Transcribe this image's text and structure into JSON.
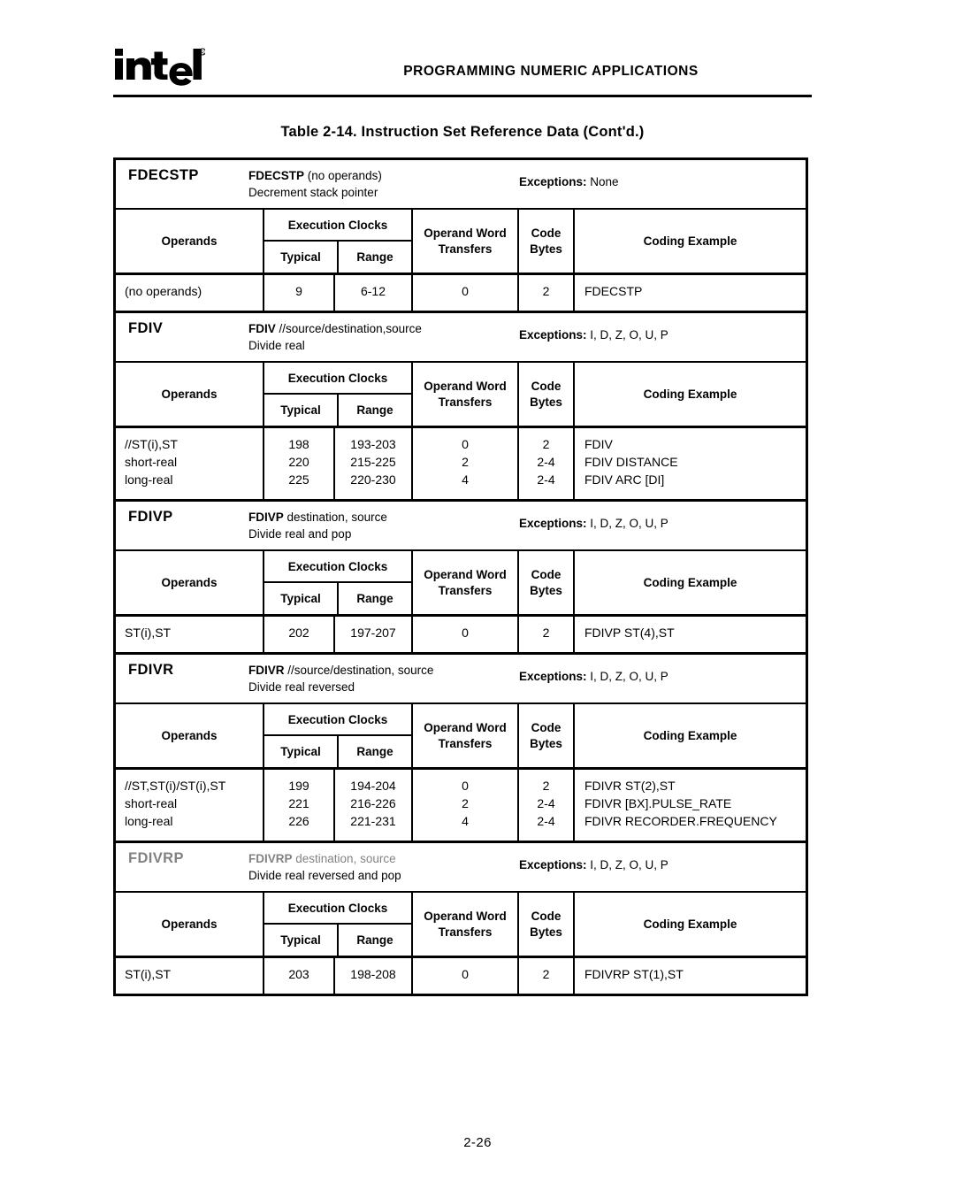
{
  "header": {
    "logo_alt": "intel",
    "logo_tm": "®",
    "title": "PROGRAMMING NUMERIC APPLICATIONS"
  },
  "table_caption": "Table 2-14.  Instruction Set Reference Data (Cont'd.)",
  "column_headers": {
    "operands": "Operands",
    "execution_clocks": "Execution Clocks",
    "typical": "Typical",
    "range": "Range",
    "operand_word_transfers_l1": "Operand Word",
    "operand_word_transfers_l2": "Transfers",
    "code_bytes_l1": "Code",
    "code_bytes_l2": "Bytes",
    "coding_example": "Coding Example"
  },
  "exceptions_label": "Exceptions:",
  "blocks": [
    {
      "mnemonic": "FDECSTP",
      "syntax_mnemonic": "FDECSTP",
      "syntax_operands": " (no operands)",
      "description": "Decrement stack pointer",
      "exceptions": "None",
      "faded": false,
      "rows": [
        {
          "operands": "(no operands)",
          "typical": "9",
          "range": "6-12",
          "operand_word_transfers": "0",
          "code_bytes": "2",
          "coding_example": "FDECSTP"
        }
      ]
    },
    {
      "mnemonic": "FDIV",
      "syntax_mnemonic": "FDIV",
      "syntax_operands": " //source/destination,source",
      "description": "Divide real",
      "exceptions": "I, D, Z, O, U, P",
      "faded": false,
      "rows": [
        {
          "operands": "//ST(i),ST",
          "typical": "198",
          "range": "193-203",
          "operand_word_transfers": "0",
          "code_bytes": "2",
          "coding_example": "FDIV"
        },
        {
          "operands": "short-real",
          "typical": "220",
          "range": "215-225",
          "operand_word_transfers": "2",
          "code_bytes": "2-4",
          "coding_example": "FDIV  DISTANCE"
        },
        {
          "operands": "long-real",
          "typical": "225",
          "range": "220-230",
          "operand_word_transfers": "4",
          "code_bytes": "2-4",
          "coding_example": "FDIV  ARC [DI]"
        }
      ]
    },
    {
      "mnemonic": "FDIVP",
      "syntax_mnemonic": "FDIVP",
      "syntax_operands": " destination, source",
      "description": "Divide real and pop",
      "exceptions": "I, D, Z, O, U, P",
      "faded": false,
      "rows": [
        {
          "operands": "ST(i),ST",
          "typical": "202",
          "range": "197-207",
          "operand_word_transfers": "0",
          "code_bytes": "2",
          "coding_example": "FDIVP  ST(4),ST"
        }
      ]
    },
    {
      "mnemonic": "FDIVR",
      "syntax_mnemonic": "FDIVR",
      "syntax_operands": " //source/destination, source",
      "description": "Divide real reversed",
      "exceptions": "I, D, Z, O, U, P",
      "faded": false,
      "rows": [
        {
          "operands": "//ST,ST(i)/ST(i),ST",
          "typical": "199",
          "range": "194-204",
          "operand_word_transfers": "0",
          "code_bytes": "2",
          "coding_example": "FDIVR  ST(2),ST"
        },
        {
          "operands": "short-real",
          "typical": "221",
          "range": "216-226",
          "operand_word_transfers": "2",
          "code_bytes": "2-4",
          "coding_example": "FDIVR  [BX].PULSE_RATE"
        },
        {
          "operands": "long-real",
          "typical": "226",
          "range": "221-231",
          "operand_word_transfers": "4",
          "code_bytes": "2-4",
          "coding_example": "FDIVR  RECORDER.FREQUENCY"
        }
      ]
    },
    {
      "mnemonic": "FDIVRP",
      "syntax_mnemonic": "FDIVRP",
      "syntax_operands": " destination, source",
      "description": "Divide real reversed and pop",
      "exceptions": "I, D, Z, O, U, P",
      "faded": true,
      "rows": [
        {
          "operands": "ST(i),ST",
          "typical": "203",
          "range": "198-208",
          "operand_word_transfers": "0",
          "code_bytes": "2",
          "coding_example": "FDIVRP  ST(1),ST"
        }
      ]
    }
  ],
  "page_number": "2-26"
}
